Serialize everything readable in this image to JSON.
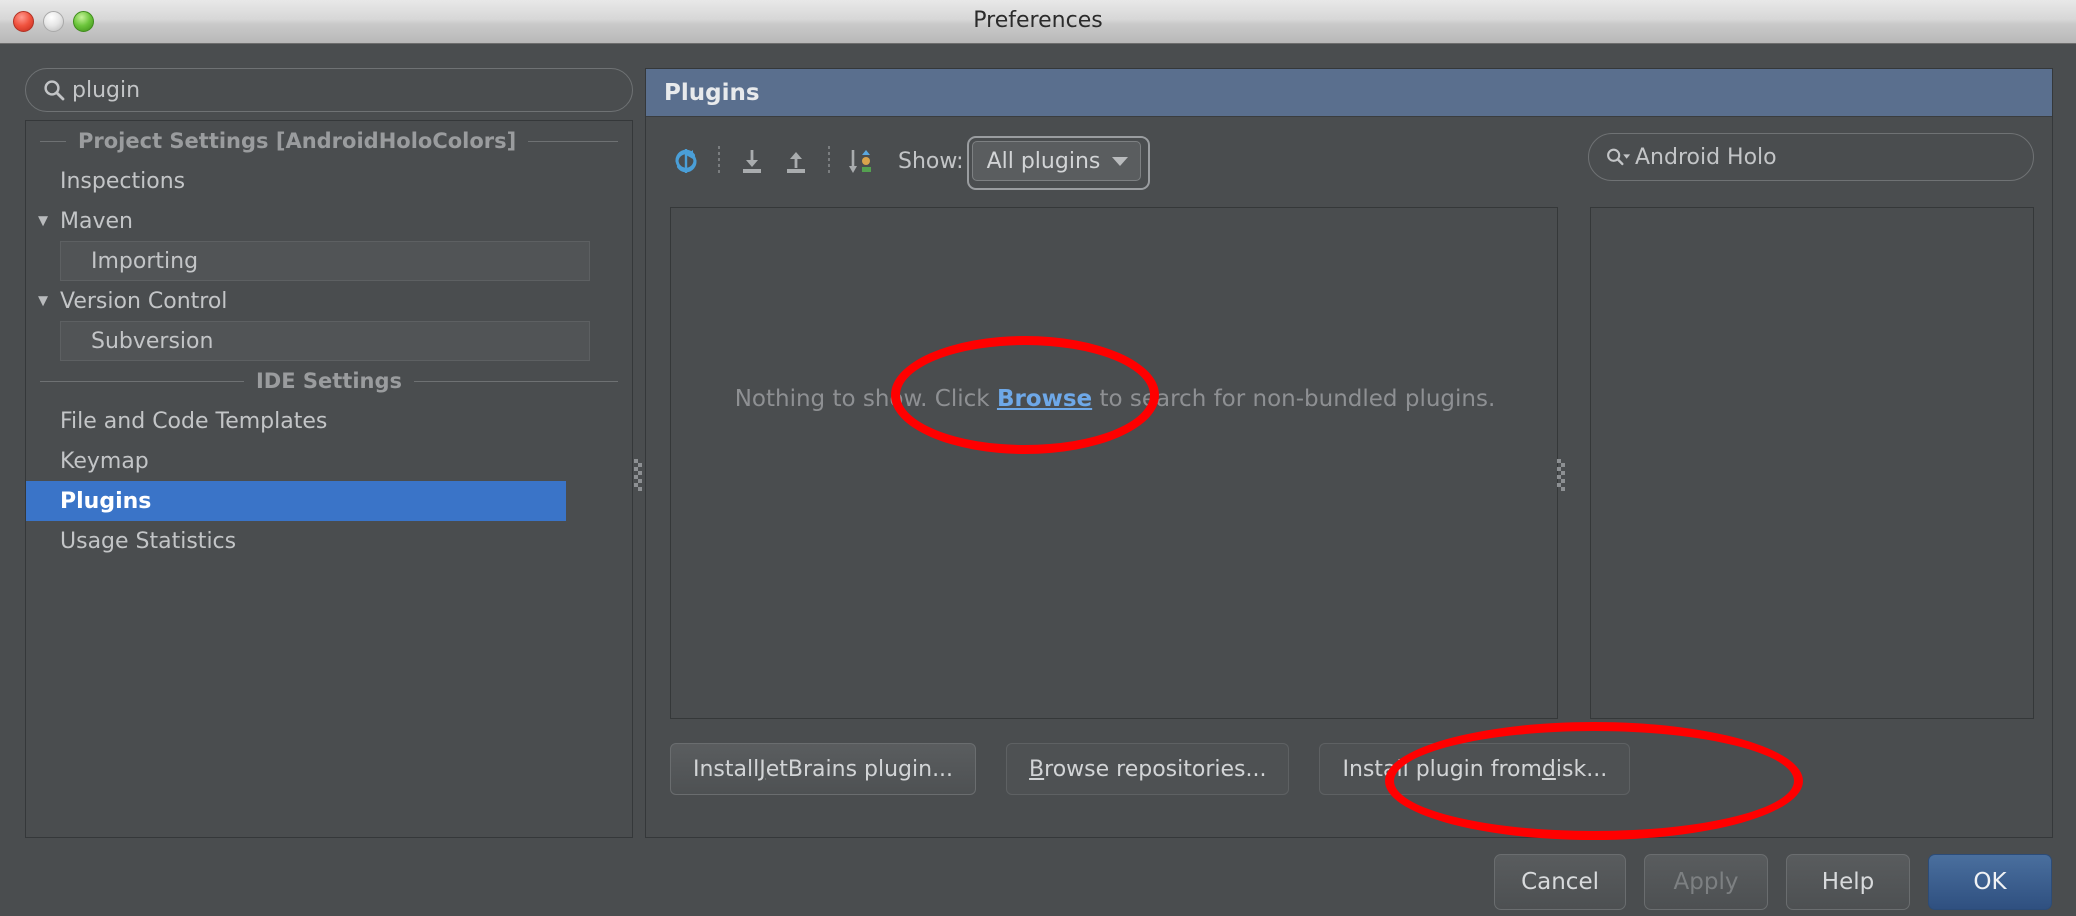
{
  "window": {
    "title": "Preferences",
    "traffic_lights": [
      "close-button",
      "minimize-button",
      "maximize-button"
    ]
  },
  "sidebar": {
    "search": {
      "value": "plugin",
      "placeholder": "",
      "icon": "search-icon"
    },
    "groups": [
      {
        "type": "separator",
        "label": "Project Settings [AndroidHoloColors]"
      },
      {
        "type": "item",
        "label": "Inspections",
        "level": 1,
        "twisty": "",
        "selected": false
      },
      {
        "type": "item",
        "label": "Maven",
        "level": 0,
        "twisty": "▼",
        "selected": false
      },
      {
        "type": "child",
        "label": "Importing",
        "selected": false
      },
      {
        "type": "item",
        "label": "Version Control",
        "level": 0,
        "twisty": "▼",
        "selected": false
      },
      {
        "type": "child",
        "label": "Subversion",
        "selected": false
      },
      {
        "type": "separator",
        "label": "IDE Settings"
      },
      {
        "type": "item",
        "label": "File and Code Templates",
        "level": 1,
        "twisty": "",
        "selected": false
      },
      {
        "type": "item",
        "label": "Keymap",
        "level": 1,
        "twisty": "",
        "selected": false
      },
      {
        "type": "item",
        "label": "Plugins",
        "level": 1,
        "twisty": "",
        "selected": true
      },
      {
        "type": "item",
        "label": "Usage Statistics",
        "level": 1,
        "twisty": "",
        "selected": false
      }
    ]
  },
  "panel": {
    "title": "Plugins",
    "toolbar": {
      "refresh_icon": "refresh-icon",
      "install_icon": "download-icon",
      "export_icon": "upload-icon",
      "sort_icon": "sort-icon",
      "show_label": "Show:",
      "filter_value": "All plugins",
      "filter_options": [
        "All plugins"
      ]
    },
    "plugin_search": {
      "value": "Android Holo",
      "icon": "search-icon"
    },
    "empty_state": {
      "before": "Nothing to show. Click ",
      "link": "Browse",
      "after": " to search for non-bundled plugins."
    },
    "actions": [
      {
        "id": "install-jetbrains-plugin",
        "pre": "Install ",
        "mnemonic": "J",
        "post": "etBrains plugin...",
        "style": "raised"
      },
      {
        "id": "browse-repositories",
        "pre": "",
        "mnemonic": "B",
        "post": "rowse repositories...",
        "style": "flat"
      },
      {
        "id": "install-plugin-from-disk",
        "pre": "Install plugin from ",
        "mnemonic": "d",
        "post": "isk...",
        "style": "flat"
      }
    ]
  },
  "footer": {
    "cancel": "Cancel",
    "apply": "Apply",
    "help": "Help",
    "ok": "OK"
  },
  "colors": {
    "accent_selection": "#3a74c8",
    "panel_header": "#5a6f8e",
    "annotation": "#ff0000",
    "default_button": "#2f5080",
    "link": "#6ea8e8"
  }
}
